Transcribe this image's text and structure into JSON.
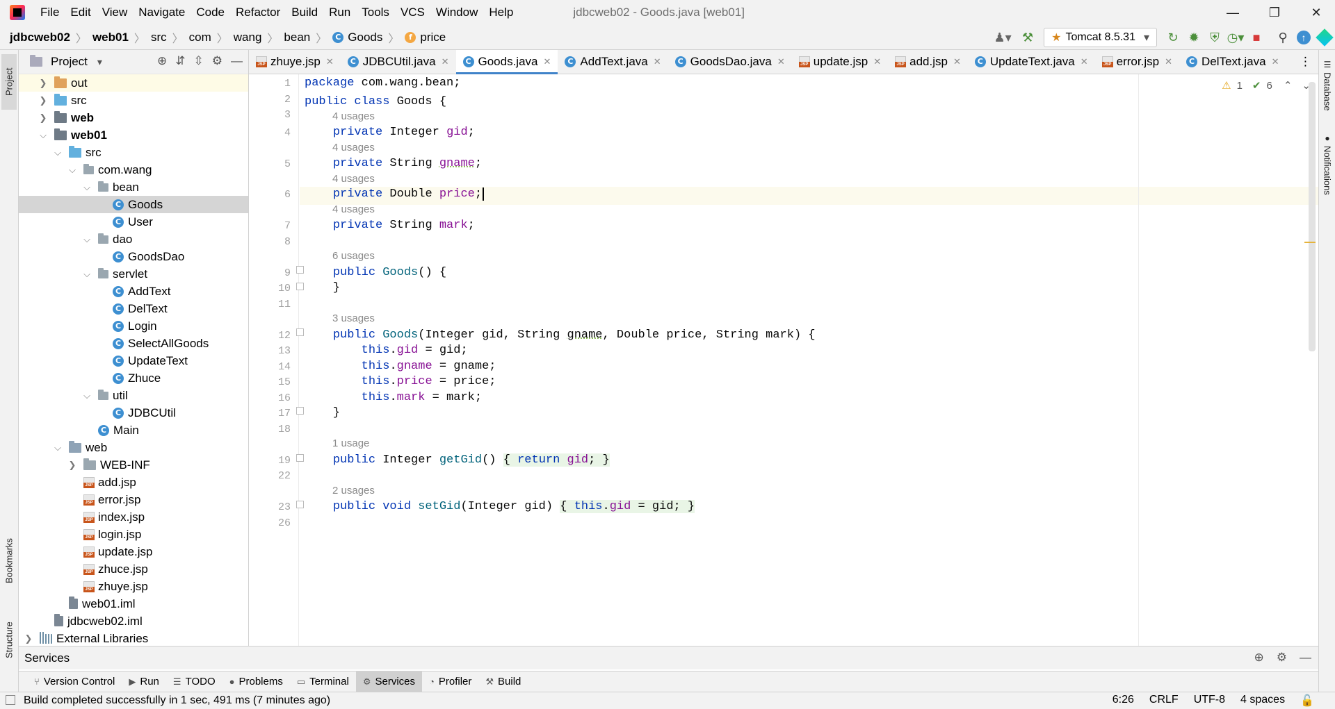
{
  "menubar": {
    "items": [
      "File",
      "Edit",
      "View",
      "Navigate",
      "Code",
      "Refactor",
      "Build",
      "Run",
      "Tools",
      "VCS",
      "Window",
      "Help"
    ],
    "window_title": "jdbcweb02 - Goods.java [web01]"
  },
  "breadcrumb": {
    "items": [
      "jdbcweb02",
      "web01",
      "src",
      "com",
      "wang",
      "bean",
      "Goods",
      "price"
    ]
  },
  "run_config": {
    "label": "Tomcat 8.5.31"
  },
  "project_panel": {
    "title": "Project",
    "tree": [
      {
        "name": "out",
        "level": 1,
        "type": "folder-orange",
        "arrow": "›"
      },
      {
        "name": "src",
        "level": 1,
        "type": "folder-blue",
        "arrow": "›"
      },
      {
        "name": "web",
        "level": 1,
        "type": "module",
        "arrow": "›",
        "bold": true
      },
      {
        "name": "web01",
        "level": 1,
        "type": "module",
        "arrow": "⌄",
        "bold": true
      },
      {
        "name": "src",
        "level": 2,
        "type": "folder-blue",
        "arrow": "⌄"
      },
      {
        "name": "com.wang",
        "level": 3,
        "type": "package",
        "arrow": "⌄"
      },
      {
        "name": "bean",
        "level": 4,
        "type": "package",
        "arrow": "⌄"
      },
      {
        "name": "Goods",
        "level": 5,
        "type": "class",
        "arrow": ""
      },
      {
        "name": "User",
        "level": 5,
        "type": "class",
        "arrow": ""
      },
      {
        "name": "dao",
        "level": 4,
        "type": "package",
        "arrow": "⌄"
      },
      {
        "name": "GoodsDao",
        "level": 5,
        "type": "class",
        "arrow": ""
      },
      {
        "name": "servlet",
        "level": 4,
        "type": "package",
        "arrow": "⌄"
      },
      {
        "name": "AddText",
        "level": 5,
        "type": "class",
        "arrow": ""
      },
      {
        "name": "DelText",
        "level": 5,
        "type": "class",
        "arrow": ""
      },
      {
        "name": "Login",
        "level": 5,
        "type": "class",
        "arrow": ""
      },
      {
        "name": "SelectAllGoods",
        "level": 5,
        "type": "class",
        "arrow": ""
      },
      {
        "name": "UpdateText",
        "level": 5,
        "type": "class",
        "arrow": ""
      },
      {
        "name": "Zhuce",
        "level": 5,
        "type": "class",
        "arrow": ""
      },
      {
        "name": "util",
        "level": 4,
        "type": "package",
        "arrow": "⌄"
      },
      {
        "name": "JDBCUtil",
        "level": 5,
        "type": "class",
        "arrow": ""
      },
      {
        "name": "Main",
        "level": 4,
        "type": "class",
        "arrow": ""
      },
      {
        "name": "web",
        "level": 2,
        "type": "folder-web",
        "arrow": "⌄"
      },
      {
        "name": "WEB-INF",
        "level": 3,
        "type": "folder",
        "arrow": "›"
      },
      {
        "name": "add.jsp",
        "level": 3,
        "type": "jsp",
        "arrow": ""
      },
      {
        "name": "error.jsp",
        "level": 3,
        "type": "jsp",
        "arrow": ""
      },
      {
        "name": "index.jsp",
        "level": 3,
        "type": "jsp",
        "arrow": ""
      },
      {
        "name": "login.jsp",
        "level": 3,
        "type": "jsp",
        "arrow": ""
      },
      {
        "name": "update.jsp",
        "level": 3,
        "type": "jsp",
        "arrow": ""
      },
      {
        "name": "zhuce.jsp",
        "level": 3,
        "type": "jsp",
        "arrow": ""
      },
      {
        "name": "zhuye.jsp",
        "level": 3,
        "type": "jsp",
        "arrow": ""
      },
      {
        "name": "web01.iml",
        "level": 2,
        "type": "iml",
        "arrow": ""
      },
      {
        "name": "jdbcweb02.iml",
        "level": 1,
        "type": "iml",
        "arrow": ""
      },
      {
        "name": "External Libraries",
        "level": 0,
        "type": "libs",
        "arrow": "›"
      }
    ]
  },
  "tabs": [
    {
      "label": "zhuye.jsp",
      "icon": "jsp"
    },
    {
      "label": "JDBCUtil.java",
      "icon": "class"
    },
    {
      "label": "Goods.java",
      "icon": "class",
      "active": true
    },
    {
      "label": "AddText.java",
      "icon": "class"
    },
    {
      "label": "GoodsDao.java",
      "icon": "class"
    },
    {
      "label": "update.jsp",
      "icon": "jsp"
    },
    {
      "label": "add.jsp",
      "icon": "jsp"
    },
    {
      "label": "UpdateText.java",
      "icon": "class"
    },
    {
      "label": "error.jsp",
      "icon": "jsp"
    },
    {
      "label": "DelText.java",
      "icon": "class"
    }
  ],
  "inspections": {
    "warnings": "1",
    "ok": "6"
  },
  "code": {
    "line_numbers": [
      "1",
      "2",
      "3",
      "4",
      "5",
      "6",
      "7",
      "8",
      "9",
      "10",
      "11",
      "12",
      "13",
      "14",
      "15",
      "16",
      "17",
      "18",
      "19",
      "22",
      "23",
      "26"
    ],
    "usages": [
      "4 usages",
      "4 usages",
      "4 usages",
      "4 usages",
      "6 usages",
      "3 usages",
      "1 usage",
      "2 usages"
    ]
  },
  "side_tabs": {
    "left": [
      "Project",
      "Bookmarks",
      "Structure"
    ],
    "right": [
      "Database",
      "Notifications"
    ]
  },
  "services_bar": {
    "title": "Services"
  },
  "bottom_tools": [
    {
      "label": "Version Control",
      "icon": "⑂"
    },
    {
      "label": "Run",
      "icon": "▶"
    },
    {
      "label": "TODO",
      "icon": "☰"
    },
    {
      "label": "Problems",
      "icon": "●"
    },
    {
      "label": "Terminal",
      "icon": "▭"
    },
    {
      "label": "Services",
      "icon": "⚙",
      "active": true
    },
    {
      "label": "Profiler",
      "icon": "◔"
    },
    {
      "label": "Build",
      "icon": "⚒"
    }
  ],
  "status": {
    "message": "Build completed successfully in 1 sec, 491 ms (7 minutes ago)",
    "position": "6:26",
    "line_sep": "CRLF",
    "encoding": "UTF-8",
    "indent": "4 spaces"
  },
  "colors": {
    "keyword": "#0033b3",
    "field": "#871094",
    "method": "#00627a",
    "accent": "#4083c9"
  }
}
